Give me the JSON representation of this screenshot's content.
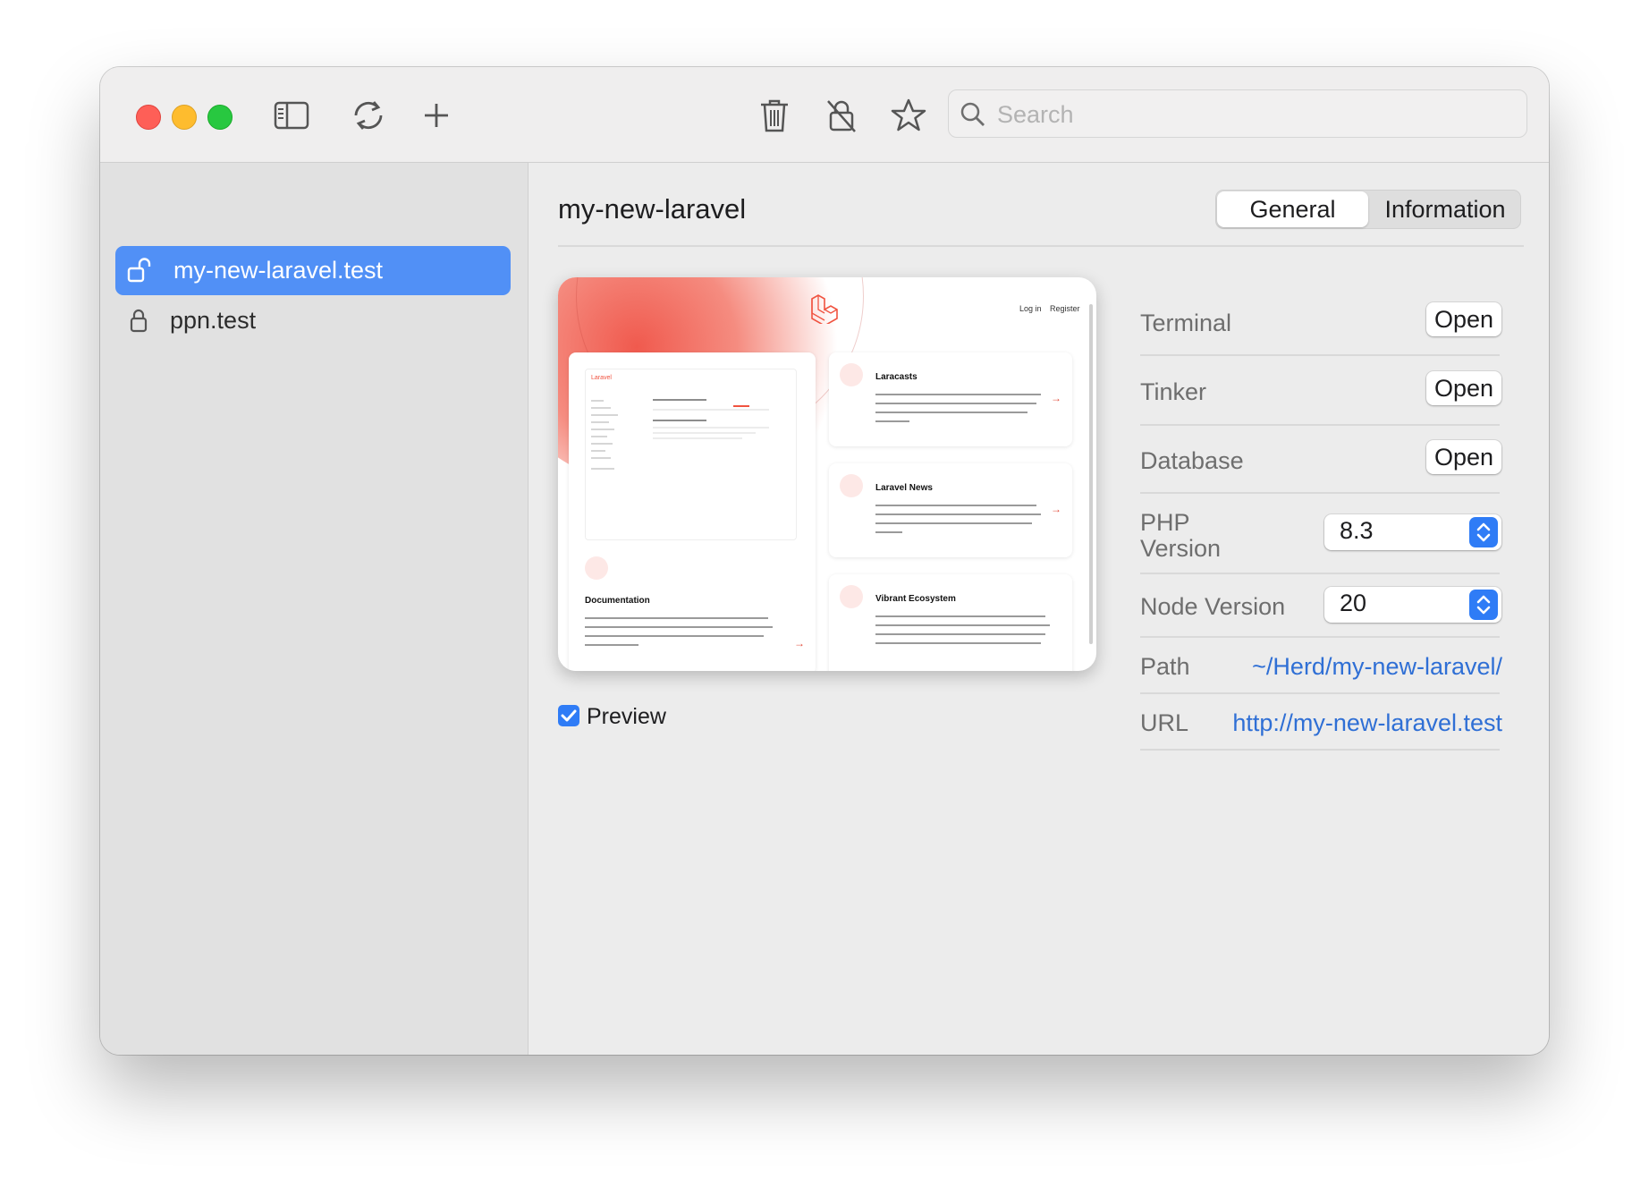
{
  "toolbar": {
    "icons": [
      "sidebar-toggle-icon",
      "refresh-icon",
      "plus-icon",
      "trash-icon",
      "lock-slash-icon",
      "star-icon",
      "search-icon"
    ],
    "search_placeholder": "Search"
  },
  "sidebar": {
    "items": [
      {
        "label": "my-new-laravel.test",
        "icon": "unlocked-icon",
        "selected": true
      },
      {
        "label": "ppn.test",
        "icon": "lock-icon",
        "selected": false
      }
    ]
  },
  "main": {
    "title": "my-new-laravel",
    "tabs": [
      {
        "label": "General",
        "active": true
      },
      {
        "label": "Information",
        "active": false
      }
    ],
    "preview": {
      "nav": [
        "Log in",
        "Register"
      ],
      "cards": [
        {
          "title": "Laracasts"
        },
        {
          "title": "Laravel News"
        },
        {
          "title": "Vibrant Ecosystem"
        },
        {
          "title": "Documentation"
        }
      ],
      "mini_logo_text": "Laravel"
    },
    "preview_checkbox": {
      "label": "Preview",
      "checked": true
    },
    "details": {
      "terminal": {
        "label": "Terminal",
        "button": "Open"
      },
      "tinker": {
        "label": "Tinker",
        "button": "Open"
      },
      "database": {
        "label": "Database",
        "button": "Open"
      },
      "php": {
        "label_line1": "PHP",
        "label_line2": "Version",
        "value": "8.3"
      },
      "node": {
        "label": "Node Version",
        "value": "20"
      },
      "path": {
        "label": "Path",
        "value": "~/Herd/my-new-laravel/"
      },
      "url": {
        "label": "URL",
        "value": "http://my-new-laravel.test"
      }
    }
  },
  "colors": {
    "accent": "#2f7cf6",
    "selection": "#5190f6",
    "link": "#2f6fd5",
    "laravel_red": "#f05340"
  }
}
